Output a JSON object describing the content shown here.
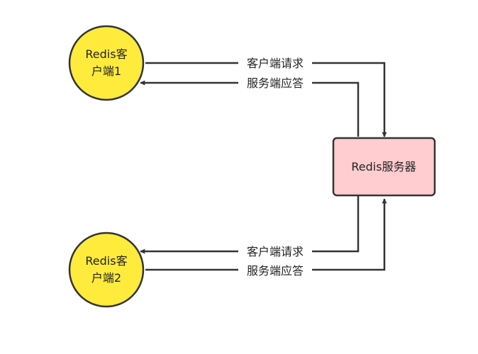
{
  "colors": {
    "client_fill": "#ffeb3b",
    "server_fill": "#ffccd0",
    "stroke": "#333333",
    "text": "#222222"
  },
  "nodes": {
    "client1": {
      "line1": "Redis客",
      "line2": "户端1"
    },
    "client2": {
      "line1": "Redis客",
      "line2": "户端2"
    },
    "server": {
      "label": "Redis服务器"
    }
  },
  "edges": {
    "client1_request": "客户端请求",
    "client1_response": "服务端应答",
    "client2_request": "客户端请求",
    "client2_response": "服务端应答"
  }
}
